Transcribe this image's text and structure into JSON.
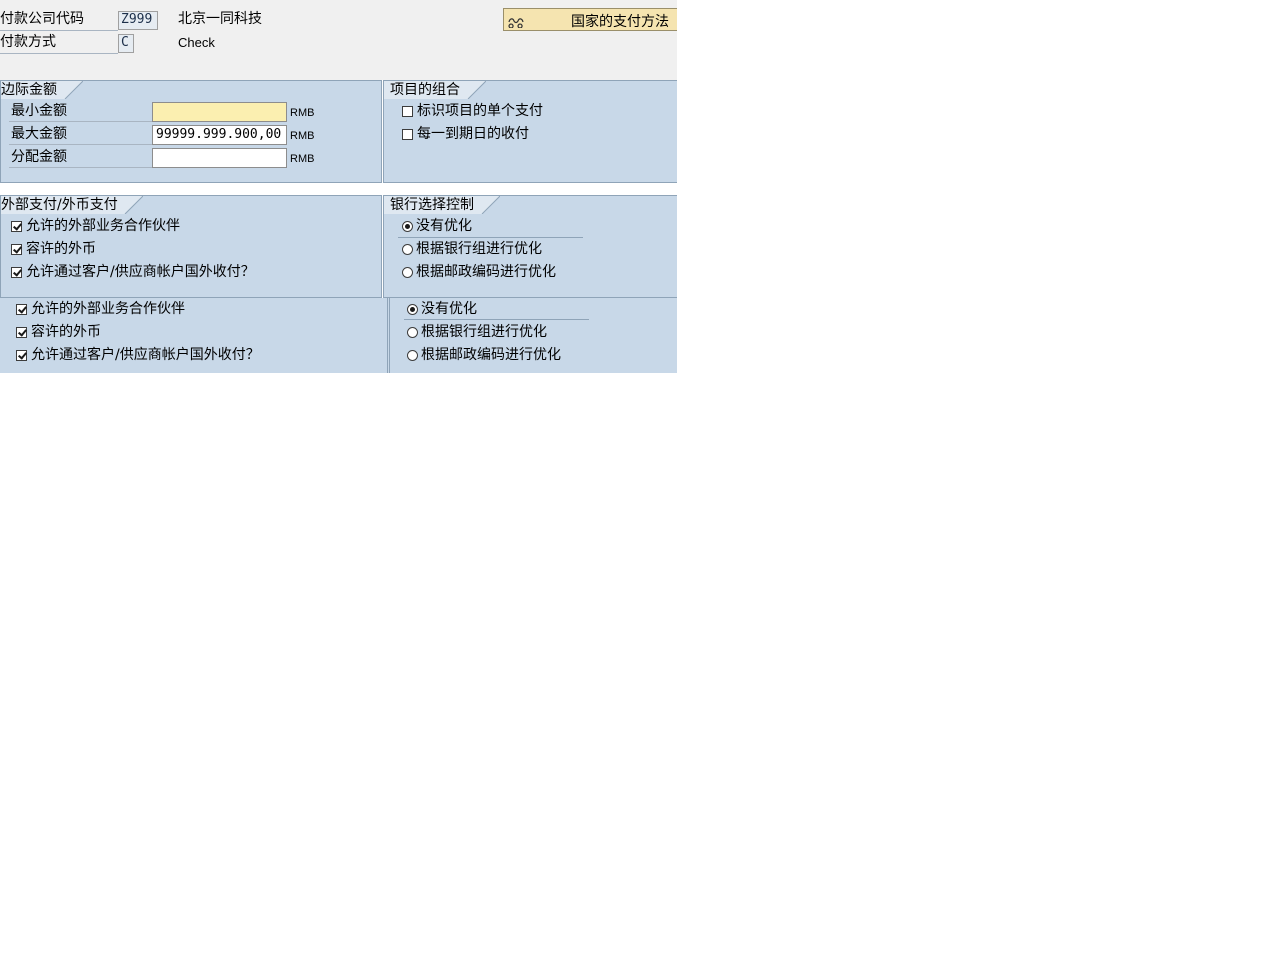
{
  "header": {
    "company_code_label": "付款公司代码",
    "company_code_value": "Z999",
    "company_name": "北京一同科技",
    "payment_method_label": "付款方式",
    "payment_method_value": "C",
    "payment_method_desc": "Check",
    "country_button_label": "国家的支付方法",
    "country_button_icon": "glasses-icon"
  },
  "amount_limits": {
    "title": "边际金额",
    "rows": [
      {
        "label": "最小金额",
        "value": "",
        "unit": "RMB"
      },
      {
        "label": "最大金额",
        "value": "99999.999.900,00",
        "unit": "RMB"
      },
      {
        "label": "分配金额",
        "value": "",
        "unit": "RMB"
      }
    ]
  },
  "item_grouping": {
    "title": "项目的组合",
    "options": [
      {
        "label": "标识项目的单个支付",
        "checked": false
      },
      {
        "label": "每一到期日的收付",
        "checked": false
      }
    ]
  },
  "foreign_payments": {
    "title": "外部支付/外币支付",
    "options": [
      {
        "label": "允许的外部业务合作伙伴",
        "checked": true
      },
      {
        "label": "容许的外币",
        "checked": true
      },
      {
        "label": "允许通过客户/供应商帐户国外收付？",
        "checked": true
      }
    ]
  },
  "bank_selection": {
    "title": "银行选择控制",
    "options": [
      {
        "label": "没有优化",
        "selected": true
      },
      {
        "label": "根据银行组进行优化",
        "selected": false
      },
      {
        "label": "根据邮政编码进行优化",
        "selected": false
      }
    ]
  },
  "lower_foreign": {
    "options": [
      {
        "label": "允许的外部业务合作伙伴",
        "checked": true
      },
      {
        "label": "容许的外币",
        "checked": true
      },
      {
        "label": "允许通过客户/供应商帐户国外收付？",
        "checked": true
      }
    ]
  },
  "lower_bank": {
    "options": [
      {
        "label": "没有优化",
        "selected": true
      },
      {
        "label": "根据银行组进行优化",
        "selected": false
      },
      {
        "label": "根据邮政编码进行优化",
        "selected": false
      }
    ]
  },
  "colors": {
    "panel_bg": "#c8d8e8",
    "header_bg": "#f0f0f0",
    "required_field_bg": "#fbefb0",
    "button_bg": "#f5e4b0"
  }
}
